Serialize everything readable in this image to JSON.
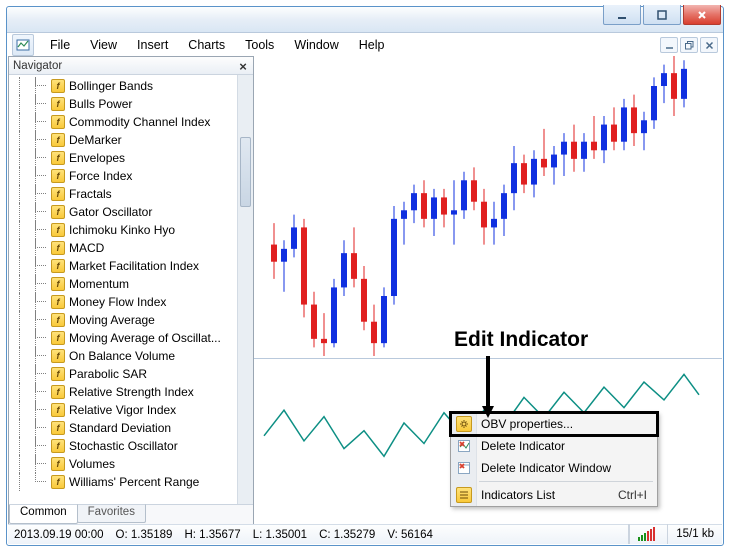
{
  "menubar": [
    "File",
    "View",
    "Insert",
    "Charts",
    "Tools",
    "Window",
    "Help"
  ],
  "navigator": {
    "title": "Navigator",
    "items": [
      "Bollinger Bands",
      "Bulls Power",
      "Commodity Channel Index",
      "DeMarker",
      "Envelopes",
      "Force Index",
      "Fractals",
      "Gator Oscillator",
      "Ichimoku Kinko Hyo",
      "MACD",
      "Market Facilitation Index",
      "Momentum",
      "Money Flow Index",
      "Moving Average",
      "Moving Average of Oscillat...",
      "On Balance Volume",
      "Parabolic SAR",
      "Relative Strength Index",
      "Relative Vigor Index",
      "Standard Deviation",
      "Stochastic Oscillator",
      "Volumes",
      "Williams' Percent Range"
    ],
    "tabs": {
      "active": "Common",
      "inactive": "Favorites"
    }
  },
  "context_menu": {
    "items": [
      {
        "label": "OBV properties...",
        "icon": "yellow-gear"
      },
      {
        "label": "Delete Indicator",
        "icon": "red-x"
      },
      {
        "label": "Delete Indicator Window",
        "icon": "red-x"
      },
      {
        "label": "Indicators List",
        "icon": "yellow-gear",
        "shortcut": "Ctrl+I"
      }
    ]
  },
  "status": {
    "datetime": "2013.09.19 00:00",
    "o": "O: 1.35189",
    "h": "H: 1.35677",
    "l": "L: 1.35001",
    "c": "C: 1.35279",
    "v": "V: 56164",
    "kb": "15/1 kb"
  },
  "annotation": "Edit Indicator",
  "chart_data": {
    "type": "candlestick",
    "main": {
      "ylim": [
        1.3,
        1.37
      ],
      "candles": [
        {
          "x": 10,
          "o": 1.326,
          "h": 1.331,
          "l": 1.318,
          "c": 1.322,
          "color": "red"
        },
        {
          "x": 20,
          "o": 1.322,
          "h": 1.327,
          "l": 1.315,
          "c": 1.325,
          "color": "blue"
        },
        {
          "x": 30,
          "o": 1.325,
          "h": 1.333,
          "l": 1.323,
          "c": 1.33,
          "color": "blue"
        },
        {
          "x": 40,
          "o": 1.33,
          "h": 1.332,
          "l": 1.309,
          "c": 1.312,
          "color": "red"
        },
        {
          "x": 50,
          "o": 1.312,
          "h": 1.315,
          "l": 1.302,
          "c": 1.304,
          "color": "red"
        },
        {
          "x": 60,
          "o": 1.304,
          "h": 1.31,
          "l": 1.3,
          "c": 1.303,
          "color": "red"
        },
        {
          "x": 70,
          "o": 1.303,
          "h": 1.318,
          "l": 1.302,
          "c": 1.316,
          "color": "blue"
        },
        {
          "x": 80,
          "o": 1.316,
          "h": 1.327,
          "l": 1.314,
          "c": 1.324,
          "color": "blue"
        },
        {
          "x": 90,
          "o": 1.324,
          "h": 1.33,
          "l": 1.316,
          "c": 1.318,
          "color": "red"
        },
        {
          "x": 100,
          "o": 1.318,
          "h": 1.321,
          "l": 1.306,
          "c": 1.308,
          "color": "red"
        },
        {
          "x": 110,
          "o": 1.308,
          "h": 1.312,
          "l": 1.3,
          "c": 1.303,
          "color": "red"
        },
        {
          "x": 120,
          "o": 1.303,
          "h": 1.316,
          "l": 1.302,
          "c": 1.314,
          "color": "blue"
        },
        {
          "x": 130,
          "o": 1.314,
          "h": 1.335,
          "l": 1.312,
          "c": 1.332,
          "color": "blue"
        },
        {
          "x": 140,
          "o": 1.332,
          "h": 1.336,
          "l": 1.326,
          "c": 1.334,
          "color": "blue"
        },
        {
          "x": 150,
          "o": 1.334,
          "h": 1.34,
          "l": 1.331,
          "c": 1.338,
          "color": "blue"
        },
        {
          "x": 160,
          "o": 1.338,
          "h": 1.341,
          "l": 1.33,
          "c": 1.332,
          "color": "red"
        },
        {
          "x": 170,
          "o": 1.332,
          "h": 1.339,
          "l": 1.328,
          "c": 1.337,
          "color": "blue"
        },
        {
          "x": 180,
          "o": 1.337,
          "h": 1.339,
          "l": 1.33,
          "c": 1.333,
          "color": "red"
        },
        {
          "x": 190,
          "o": 1.333,
          "h": 1.341,
          "l": 1.326,
          "c": 1.334,
          "color": "blue"
        },
        {
          "x": 200,
          "o": 1.334,
          "h": 1.343,
          "l": 1.332,
          "c": 1.341,
          "color": "blue"
        },
        {
          "x": 210,
          "o": 1.341,
          "h": 1.344,
          "l": 1.334,
          "c": 1.336,
          "color": "red"
        },
        {
          "x": 220,
          "o": 1.336,
          "h": 1.339,
          "l": 1.326,
          "c": 1.33,
          "color": "red"
        },
        {
          "x": 230,
          "o": 1.33,
          "h": 1.336,
          "l": 1.326,
          "c": 1.332,
          "color": "blue"
        },
        {
          "x": 240,
          "o": 1.332,
          "h": 1.34,
          "l": 1.328,
          "c": 1.338,
          "color": "blue"
        },
        {
          "x": 250,
          "o": 1.338,
          "h": 1.349,
          "l": 1.334,
          "c": 1.345,
          "color": "blue"
        },
        {
          "x": 260,
          "o": 1.345,
          "h": 1.347,
          "l": 1.338,
          "c": 1.34,
          "color": "red"
        },
        {
          "x": 270,
          "o": 1.34,
          "h": 1.348,
          "l": 1.337,
          "c": 1.346,
          "color": "blue"
        },
        {
          "x": 280,
          "o": 1.346,
          "h": 1.353,
          "l": 1.342,
          "c": 1.344,
          "color": "red"
        },
        {
          "x": 290,
          "o": 1.344,
          "h": 1.349,
          "l": 1.34,
          "c": 1.347,
          "color": "blue"
        },
        {
          "x": 300,
          "o": 1.347,
          "h": 1.352,
          "l": 1.342,
          "c": 1.35,
          "color": "blue"
        },
        {
          "x": 310,
          "o": 1.35,
          "h": 1.354,
          "l": 1.343,
          "c": 1.346,
          "color": "red"
        },
        {
          "x": 320,
          "o": 1.346,
          "h": 1.352,
          "l": 1.343,
          "c": 1.35,
          "color": "blue"
        },
        {
          "x": 330,
          "o": 1.35,
          "h": 1.356,
          "l": 1.346,
          "c": 1.348,
          "color": "red"
        },
        {
          "x": 340,
          "o": 1.348,
          "h": 1.356,
          "l": 1.345,
          "c": 1.354,
          "color": "blue"
        },
        {
          "x": 350,
          "o": 1.354,
          "h": 1.358,
          "l": 1.348,
          "c": 1.35,
          "color": "red"
        },
        {
          "x": 360,
          "o": 1.35,
          "h": 1.36,
          "l": 1.348,
          "c": 1.358,
          "color": "blue"
        },
        {
          "x": 370,
          "o": 1.358,
          "h": 1.361,
          "l": 1.349,
          "c": 1.352,
          "color": "red"
        },
        {
          "x": 380,
          "o": 1.352,
          "h": 1.357,
          "l": 1.348,
          "c": 1.355,
          "color": "blue"
        },
        {
          "x": 390,
          "o": 1.355,
          "h": 1.365,
          "l": 1.353,
          "c": 1.363,
          "color": "blue"
        },
        {
          "x": 400,
          "o": 1.363,
          "h": 1.368,
          "l": 1.359,
          "c": 1.366,
          "color": "blue"
        },
        {
          "x": 410,
          "o": 1.366,
          "h": 1.37,
          "l": 1.356,
          "c": 1.36,
          "color": "red"
        },
        {
          "x": 420,
          "o": 1.36,
          "h": 1.369,
          "l": 1.358,
          "c": 1.367,
          "color": "blue"
        }
      ]
    },
    "sub": {
      "indicator": "OBV",
      "color": "teal",
      "ylim": [
        0,
        100
      ],
      "points": [
        [
          0,
          40
        ],
        [
          20,
          60
        ],
        [
          40,
          36
        ],
        [
          60,
          55
        ],
        [
          80,
          30
        ],
        [
          100,
          44
        ],
        [
          120,
          24
        ],
        [
          140,
          50
        ],
        [
          160,
          34
        ],
        [
          180,
          58
        ],
        [
          200,
          40
        ],
        [
          220,
          60
        ],
        [
          240,
          48
        ],
        [
          260,
          70
        ],
        [
          280,
          54
        ],
        [
          300,
          74
        ],
        [
          320,
          58
        ],
        [
          340,
          78
        ],
        [
          360,
          62
        ],
        [
          380,
          82
        ],
        [
          400,
          68
        ],
        [
          420,
          88
        ],
        [
          435,
          72
        ]
      ]
    }
  }
}
